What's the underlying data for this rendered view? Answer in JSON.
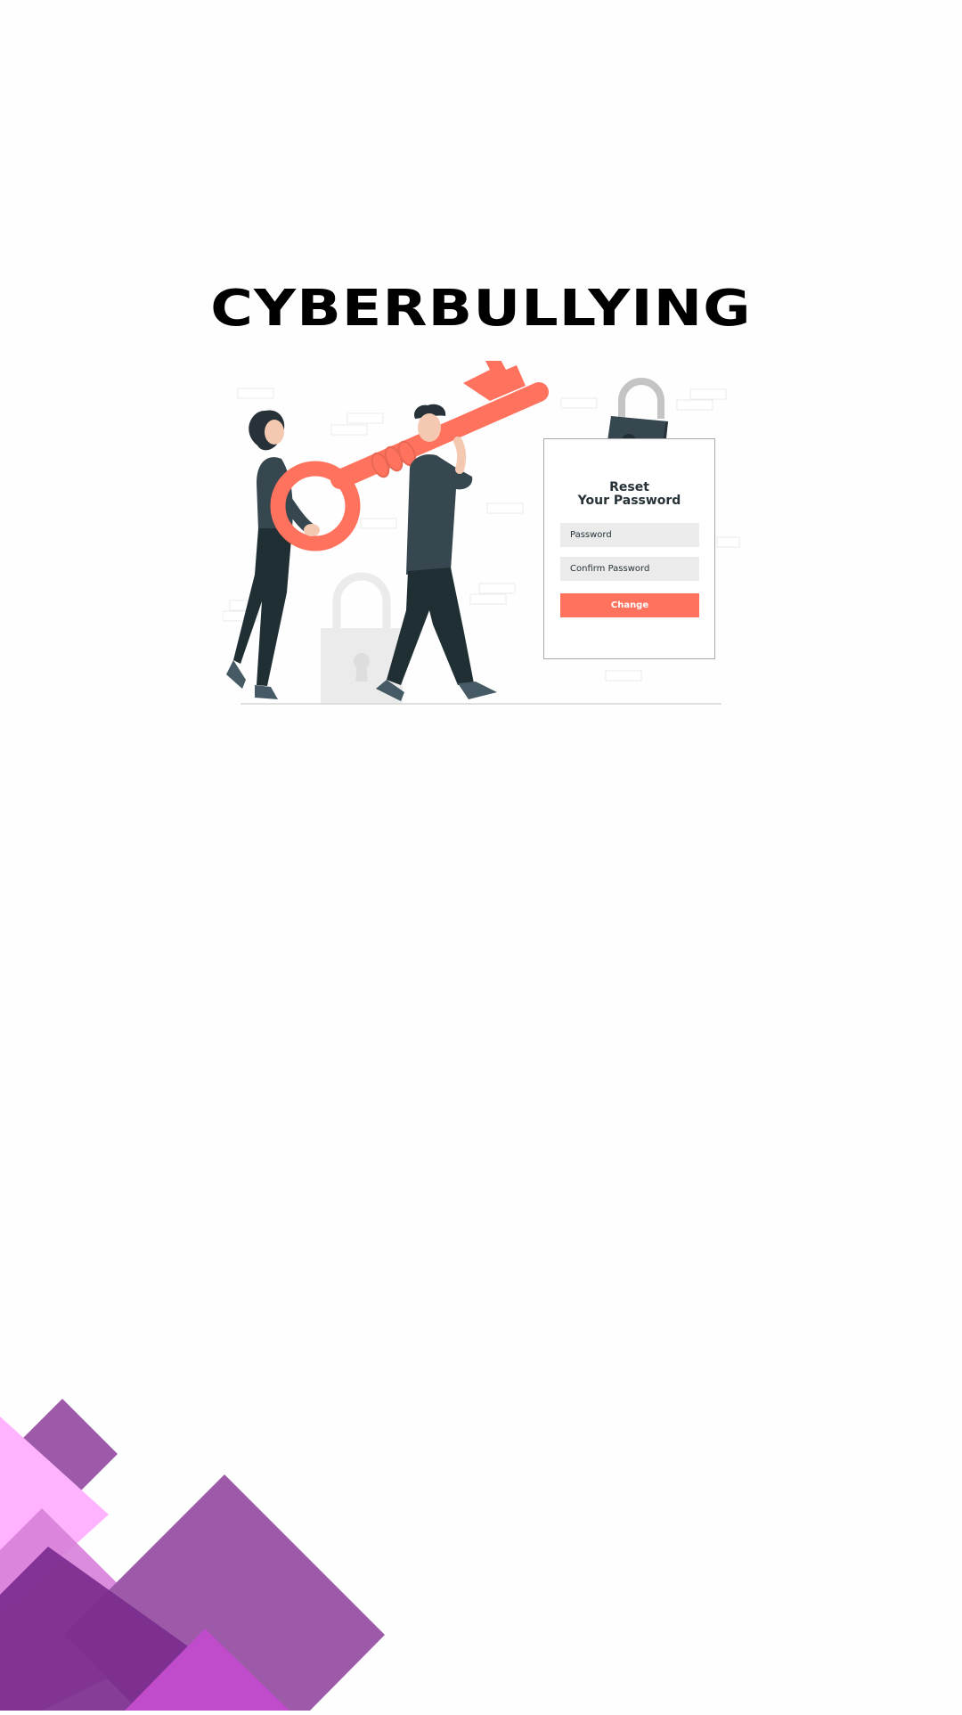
{
  "page": {
    "title": "CYBERBULLYING"
  },
  "reset_card": {
    "title_line1": "Reset",
    "title_line2": "Your Password",
    "password_placeholder": "Password",
    "confirm_placeholder": "Confirm Password",
    "submit_label": "Change"
  },
  "colors": {
    "accent": "#ff725e",
    "dark": "#263238",
    "purple_primary": "#7b2d8e",
    "purple_light": "#ffb3ff",
    "purple_mid": "#9c5aa8",
    "magenta": "#c04bcb"
  },
  "icons": [
    "key-icon",
    "padlock-icon",
    "background-padlock-icon"
  ]
}
